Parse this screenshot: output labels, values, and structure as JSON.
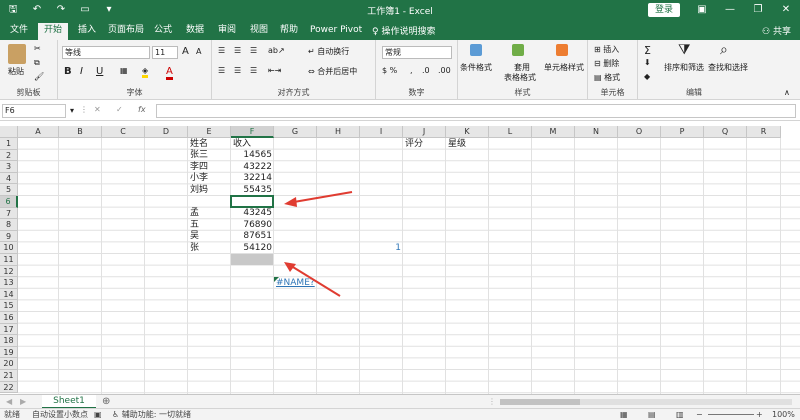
{
  "app": {
    "title": "工作簿1 - Excel",
    "login_label": "登录",
    "share_label": "共享"
  },
  "tabs": [
    "文件",
    "开始",
    "插入",
    "页面布局",
    "公式",
    "数据",
    "审阅",
    "视图",
    "帮助",
    "Power Pivot"
  ],
  "tell_me": "操作说明搜索",
  "ribbon": {
    "clipboard": {
      "label": "剪贴板",
      "paste": "粘贴"
    },
    "font": {
      "label": "字体",
      "name": "等线",
      "size": "11",
      "bold": "B",
      "italic": "I",
      "underline": "U",
      "grow": "A",
      "shrink": "A",
      "color_letter": "A"
    },
    "alignment": {
      "label": "对齐方式",
      "wrap": "自动换行",
      "merge": "合并后居中"
    },
    "number": {
      "label": "数字",
      "format": "常规"
    },
    "styles": {
      "label": "样式",
      "conditional": "条件格式",
      "table_1": "套用",
      "table_2": "表格格式",
      "cell_styles": "单元格样式"
    },
    "cells": {
      "label": "单元格",
      "insert": "插入",
      "delete": "删除",
      "format": "格式"
    },
    "editing": {
      "label": "编辑",
      "sort": "排序和筛选",
      "find": "查找和选择"
    }
  },
  "formula_bar": {
    "name_box": "F6",
    "fx": "fx",
    "formula": ""
  },
  "columns": [
    "A",
    "B",
    "C",
    "D",
    "E",
    "F",
    "G",
    "H",
    "I",
    "J",
    "K",
    "L",
    "M",
    "N",
    "O",
    "P",
    "Q",
    "R"
  ],
  "rows": [
    "1",
    "2",
    "3",
    "4",
    "5",
    "6",
    "7",
    "8",
    "9",
    "10",
    "11",
    "12",
    "13",
    "14",
    "15",
    "16",
    "17",
    "18",
    "19",
    "20",
    "21",
    "22"
  ],
  "cells": {
    "E1": "姓名",
    "F1": "收入",
    "J1": "评分",
    "K1": "星级",
    "E2": "张三",
    "F2": "14565",
    "E3": "李四",
    "F3": "43222",
    "E4": "小李",
    "F4": "32214",
    "E5": "刘妈",
    "F5": "55435",
    "E7": "孟",
    "F7": "43245",
    "E8": "五",
    "F8": "76890",
    "E9": "吴",
    "F9": "87651",
    "E10": "张",
    "F10": "54120",
    "I10": "1",
    "G13": "#NAME?"
  },
  "sheet_tab": "Sheet1",
  "status": {
    "ready": "就绪",
    "auto_decimal": "自动设置小数点",
    "accessibility": "辅助功能: 一切就绪",
    "zoom": "100%"
  },
  "colors": {
    "brand": "#217346",
    "arrow": "#e03c31",
    "link": "#2e75b6",
    "gray_cell": "#c8c8c8"
  }
}
